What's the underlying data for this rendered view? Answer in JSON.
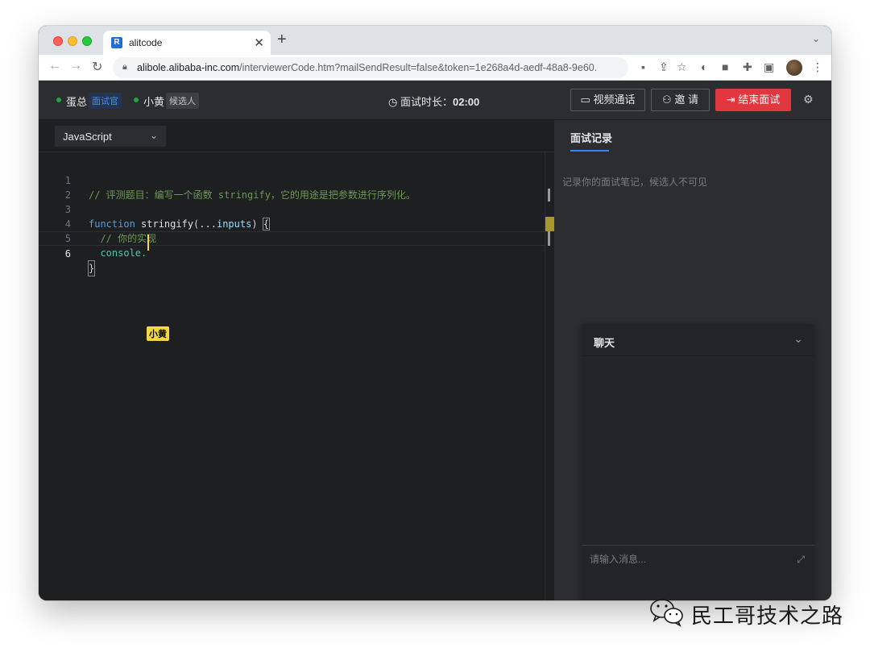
{
  "browser": {
    "tab_title": "alitcode",
    "tab_favicon": "R",
    "url_host": "alibole.alibaba-inc.com",
    "url_path": "/interviewerCode.htm?mailSendResult=false&token=1e268a4d-aedf-48a8-9e60..."
  },
  "header": {
    "interviewer_name": "蛋总",
    "interviewer_role": "面试官",
    "candidate_name": "小黄",
    "candidate_role": "候选人",
    "timer_label": "面试时长：",
    "timer_value": "02:00",
    "video_call_label": "视频通话",
    "invite_label": "邀 请",
    "end_interview_label": "结束面试"
  },
  "editor": {
    "language": "JavaScript",
    "lines": [
      {
        "num": "1",
        "text": "// 评测题目：编写一个函数 stringify，它的用途是把参数进行序列化。"
      },
      {
        "num": "2",
        "text": ""
      },
      {
        "num": "3",
        "kw": "function",
        "fn": " stringify",
        "open": "(",
        "rest": "...",
        "param": "inputs",
        "close": ") ",
        "brace": "{"
      },
      {
        "num": "4",
        "text": "  // 你的实现"
      },
      {
        "num": "5",
        "text": "  console."
      },
      {
        "num": "6",
        "text": "}"
      }
    ],
    "remote_cursor_user": "小黄"
  },
  "notes": {
    "tab_label": "面试记录",
    "placeholder": "记录你的面试笔记，候选人不可见"
  },
  "chat": {
    "title": "聊天",
    "input_placeholder": "请输入消息..."
  },
  "watermark": {
    "text": "民工哥技术之路"
  },
  "colors": {
    "end_button": "#e0383e",
    "accent_blue": "#3b82f6",
    "remote_cursor": "#f5d742",
    "online_dot": "#23a344"
  }
}
